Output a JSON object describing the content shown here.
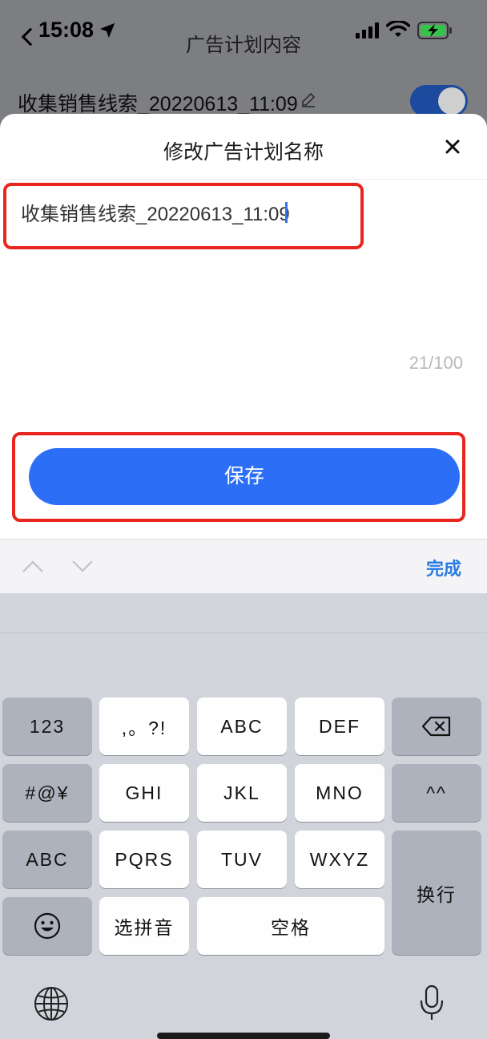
{
  "status_bar": {
    "time": "15:08"
  },
  "nav": {
    "title": "广告计划内容"
  },
  "plan_row": {
    "name": "收集销售线索_20220613_11:09",
    "enabled": true
  },
  "sheet": {
    "title": "修改广告计划名称",
    "input_value": "收集销售线索_20220613_11:09",
    "char_count": "21/100",
    "save_label": "保存"
  },
  "accessory": {
    "done_label": "完成"
  },
  "keyboard": {
    "row1": [
      "123",
      ",。?!",
      "ABC",
      "DEF"
    ],
    "row2": [
      "#@¥",
      "GHI",
      "JKL",
      "MNO",
      "^^"
    ],
    "row3": [
      "ABC",
      "PQRS",
      "TUV",
      "WXYZ"
    ],
    "row4": [
      "选拼音",
      "空格"
    ],
    "return_label": "换行"
  },
  "colors": {
    "accent": "#2d6ef6",
    "highlight": "#e8261f",
    "done": "#2a7be4"
  },
  "icons": [
    "back-chevron-icon",
    "location-arrow-icon",
    "signal-icon",
    "wifi-icon",
    "battery-charging-icon",
    "pencil-icon",
    "close-icon",
    "chevron-up-icon",
    "chevron-down-icon",
    "delete-icon",
    "emoji-icon",
    "globe-icon",
    "microphone-icon"
  ]
}
